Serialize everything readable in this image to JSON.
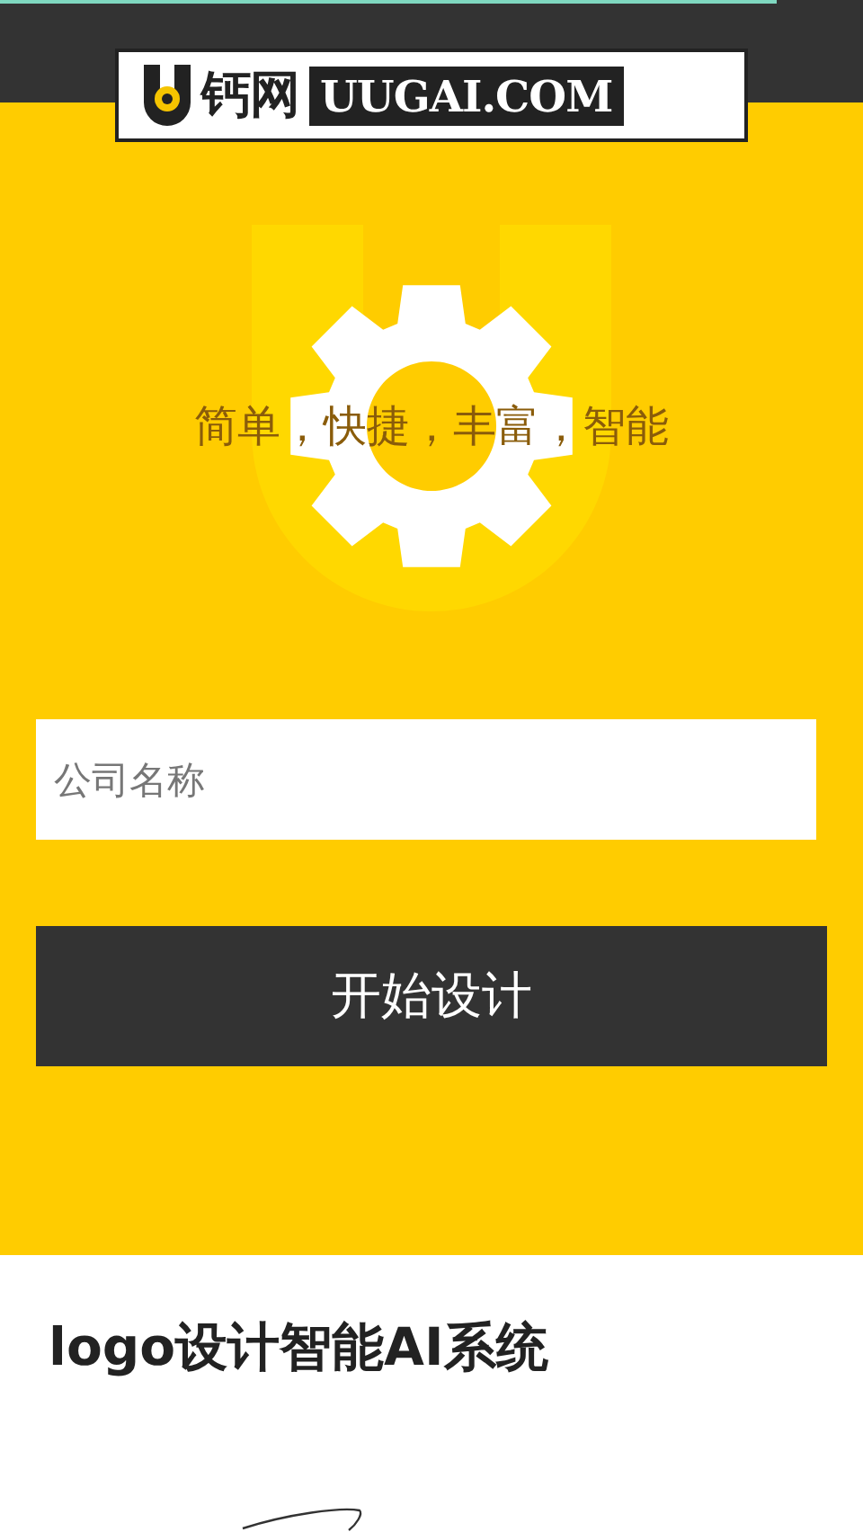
{
  "header": {
    "logo_name": "钙网",
    "logo_domain": "UUGAI.COM"
  },
  "hero": {
    "tagline": "简单，快捷，丰富，智能",
    "company_field": {
      "placeholder": "公司名称"
    },
    "start_button": "开始设计"
  },
  "intro": {
    "heading": "logo设计智能AI系统"
  }
}
